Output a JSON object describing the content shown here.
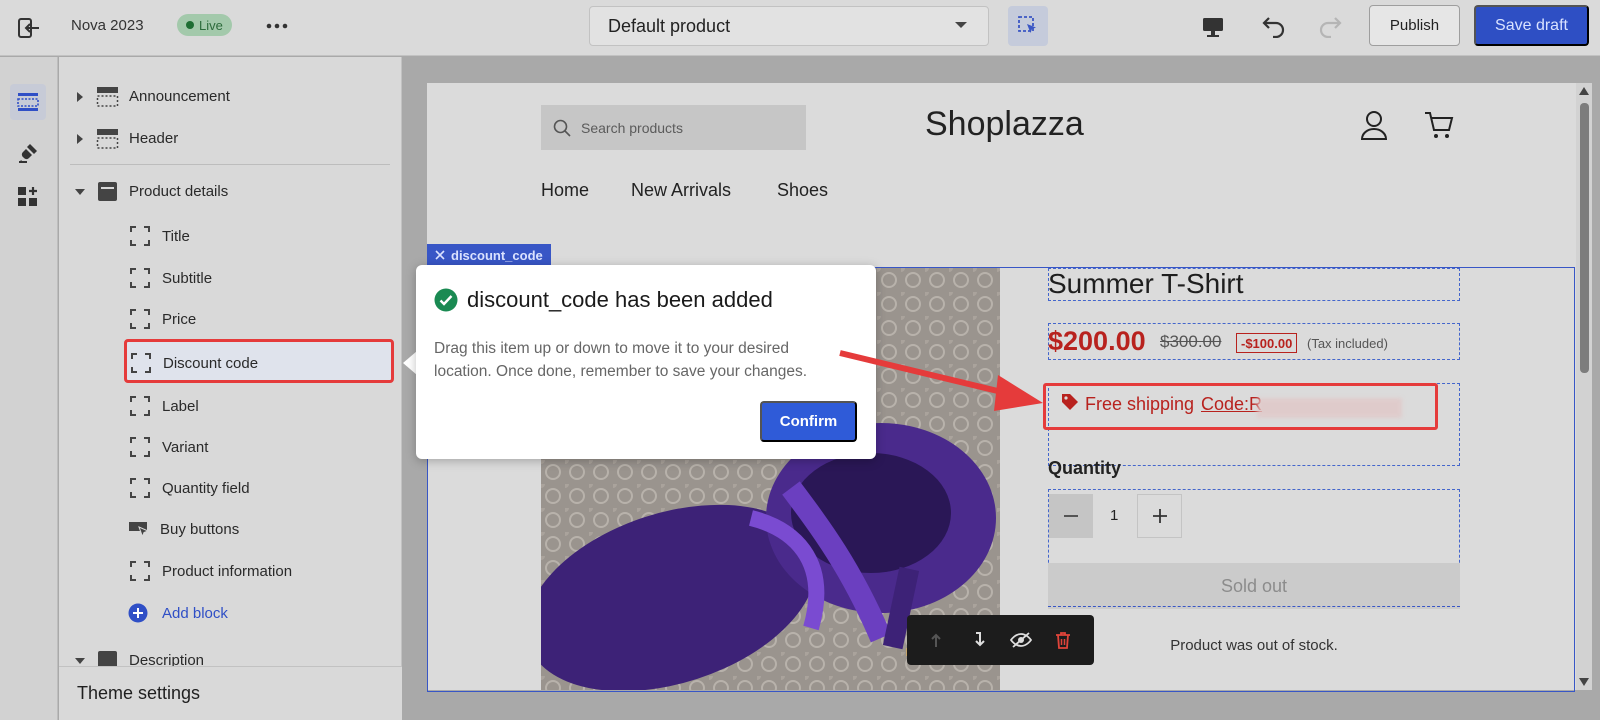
{
  "topbar": {
    "store_name": "Nova 2023",
    "live_label": "Live",
    "template_select": "Default product",
    "publish_label": "Publish",
    "save_label": "Save draft"
  },
  "sidebar": {
    "sections": [
      {
        "label": "Announcement",
        "expanded": false
      },
      {
        "label": "Header",
        "expanded": false
      },
      {
        "label": "Product details",
        "expanded": true
      },
      {
        "label": "Description",
        "expanded": true
      }
    ],
    "blocks": [
      {
        "label": "Title",
        "icon": "block-icon"
      },
      {
        "label": "Subtitle",
        "icon": "block-icon"
      },
      {
        "label": "Price",
        "icon": "block-icon"
      },
      {
        "label": "Discount code",
        "icon": "block-icon",
        "highlighted": true
      },
      {
        "label": "Label",
        "icon": "block-icon"
      },
      {
        "label": "Variant",
        "icon": "block-icon"
      },
      {
        "label": "Quantity field",
        "icon": "block-icon"
      },
      {
        "label": "Buy buttons",
        "icon": "cursor-block-icon"
      },
      {
        "label": "Product information",
        "icon": "block-icon"
      }
    ],
    "add_block_label": "Add block",
    "theme_settings_label": "Theme settings"
  },
  "preview": {
    "search_placeholder": "Search products",
    "logo": "Shoplazza",
    "nav": [
      "Home",
      "New Arrivals",
      "Shoes"
    ],
    "selection_tag": "discount_code",
    "product": {
      "title": "Summer T-Shirt",
      "price": "$200.00",
      "compare_price": "$300.00",
      "discount_badge": "-$100.00",
      "tax_note": "(Tax included)",
      "discount_text": "Free shipping",
      "discount_code": "Code:R",
      "quantity_label": "Quantity",
      "quantity_value": "1",
      "sold_out_label": "Sold out",
      "out_of_stock_message": "Product was out of stock."
    }
  },
  "popover": {
    "title": "discount_code has been added",
    "body": "Drag this item up or down to move it to your desired location. Once done, remember to save your changes.",
    "confirm_label": "Confirm"
  },
  "colors": {
    "accent": "#2e4fc4",
    "highlight_red": "#e53b3b",
    "price_red": "#b8221e",
    "live_green": "#1e6e33"
  }
}
